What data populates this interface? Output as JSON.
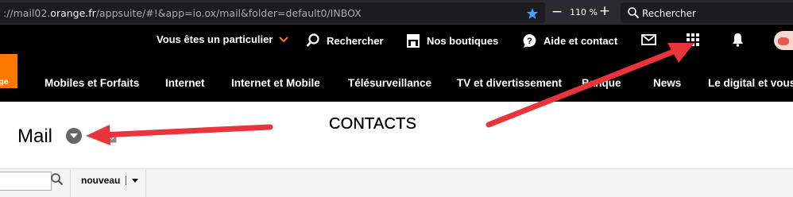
{
  "browser": {
    "url_host_prefix": "://mail02.",
    "url_host": "orange.fr",
    "url_path": "/appsuite/#!&app=io.ox/mail&folder=default0/INBOX",
    "zoom_level": "110 %",
    "search_placeholder": "Rechercher",
    "accent_color": "#45a1ff"
  },
  "top_nav": {
    "particulier": "Vous êtes un particulier",
    "rechercher": "Rechercher",
    "boutiques": "Nos boutiques",
    "aide": "Aide et contact",
    "logo_text": "nge",
    "brand_color": "#ff7900"
  },
  "main_nav": {
    "items": [
      "Mobiles et Forfaits",
      "Internet",
      "Internet et Mobile",
      "Télésurveillance",
      "TV et divertissement",
      "Banque",
      "News",
      "Le digital et vous"
    ]
  },
  "content": {
    "mail_title": "Mail",
    "annotation_label": "CONTACTS"
  },
  "toolbar": {
    "search_value": "",
    "new_label": "nouveau"
  },
  "annotation": {
    "color": "#e8343a"
  }
}
